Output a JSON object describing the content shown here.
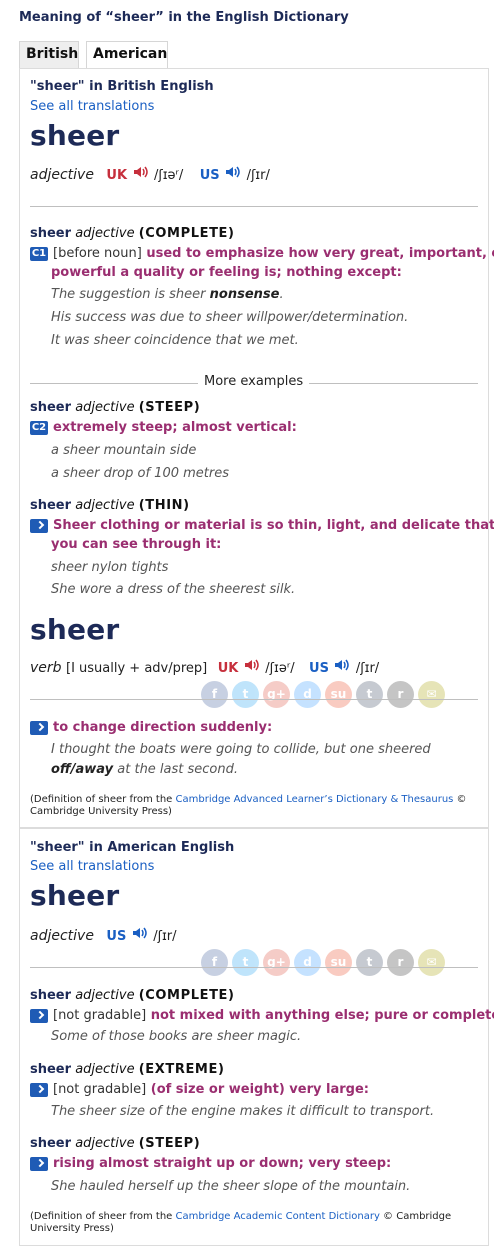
{
  "page_title": "Meaning of “sheer” in the English Dictionary",
  "tabs": [
    {
      "label": "British"
    },
    {
      "label": "American"
    }
  ],
  "british": {
    "section_head": "\"sheer\" in British English",
    "see_all": "See all translations",
    "entry1": {
      "headword": "sheer",
      "pos": "adjective",
      "uk": "UK",
      "uk_ipa": "/ʃɪəʳ/",
      "us": "US",
      "us_ipa": "/ʃɪr/",
      "senses": [
        {
          "hw": "sheer",
          "pos": "adjective",
          "guide": "(COMPLETE)",
          "level": "C1",
          "grammar": "[before noun]",
          "def_line1": "used to emphasize how very great, important, or",
          "def_line2": "powerful a quality or feeling is; nothing except:",
          "examples": [
            {
              "pre": "The suggestion is sheer ",
              "bold": "nonsense",
              "post": "."
            },
            {
              "text": "His success was due to sheer willpower/determination."
            },
            {
              "text": "It was sheer coincidence that we met."
            }
          ]
        },
        {
          "hw": "sheer",
          "pos": "adjective",
          "guide": "(STEEP)",
          "level": "C2",
          "def_line1": "extremely steep; almost vertical:",
          "examples": [
            {
              "text": "a sheer mountain side"
            },
            {
              "text": "a sheer drop of 100 metres"
            }
          ]
        },
        {
          "hw": "sheer",
          "pos": "adjective",
          "guide": "(THIN)",
          "def_line1": "Sheer clothing or material is so thin, light, and delicate that",
          "def_line2": "you can see through it:",
          "examples": [
            {
              "text": "sheer nylon tights"
            },
            {
              "text": "She wore a dress of the sheerest silk."
            }
          ]
        }
      ],
      "more_examples": "More examples"
    },
    "entry2": {
      "headword": "sheer",
      "pos": "verb",
      "grammar": "[I usually + adv/prep]",
      "uk": "UK",
      "uk_ipa": "/ʃɪəʳ/",
      "us": "US",
      "us_ipa": "/ʃɪr/",
      "def_line1": "to change direction suddenly:",
      "example_line1": "I thought the boats were going to collide, but one sheered",
      "example_bold": "off/away",
      "example_post": " at the last second."
    },
    "credit_pre": "(Definition of sheer from the ",
    "credit_link": "Cambridge Advanced Learner’s Dictionary & Thesaurus",
    "credit_post": " ©",
    "credit_line2": "Cambridge University Press)"
  },
  "american": {
    "section_head": "\"sheer\" in American English",
    "see_all": "See all translations",
    "headword": "sheer",
    "pos": "adjective",
    "us": "US",
    "us_ipa": "/ʃɪr/",
    "senses": [
      {
        "hw": "sheer",
        "pos": "adjective",
        "guide": "(COMPLETE)",
        "grammar": "[not gradable]",
        "def": "not mixed with anything else; pure or complete:",
        "example": "Some of those books are sheer magic."
      },
      {
        "hw": "sheer",
        "pos": "adjective",
        "guide": "(EXTREME)",
        "grammar": "[not gradable]",
        "def": "(of size or weight) very large:",
        "example": "The sheer size of the engine makes it difficult to transport."
      },
      {
        "hw": "sheer",
        "pos": "adjective",
        "guide": "(STEEP)",
        "def": "rising almost straight up or down; very steep:",
        "example": "She hauled herself up the sheer slope of the mountain."
      }
    ],
    "credit_pre": "(Definition of sheer from the ",
    "credit_link": "Cambridge Academic Content Dictionary",
    "credit_post": " © Cambridge",
    "credit_line2": "University Press)"
  },
  "social_icons": [
    {
      "name": "facebook-icon",
      "glyph": "f",
      "color": "#3b5998"
    },
    {
      "name": "twitter-icon",
      "glyph": "t",
      "color": "#1da1f2"
    },
    {
      "name": "googleplus-icon",
      "glyph": "g+",
      "color": "#dd4b39"
    },
    {
      "name": "delicious-icon",
      "glyph": "d",
      "color": "#3399ff"
    },
    {
      "name": "stumbleupon-icon",
      "glyph": "su",
      "color": "#eb4924"
    },
    {
      "name": "tumblr-icon",
      "glyph": "t",
      "color": "#35465c"
    },
    {
      "name": "reddit-icon",
      "glyph": "r",
      "color": "#333333"
    },
    {
      "name": "email-icon",
      "glyph": "✉",
      "color": "#a8a000"
    }
  ]
}
